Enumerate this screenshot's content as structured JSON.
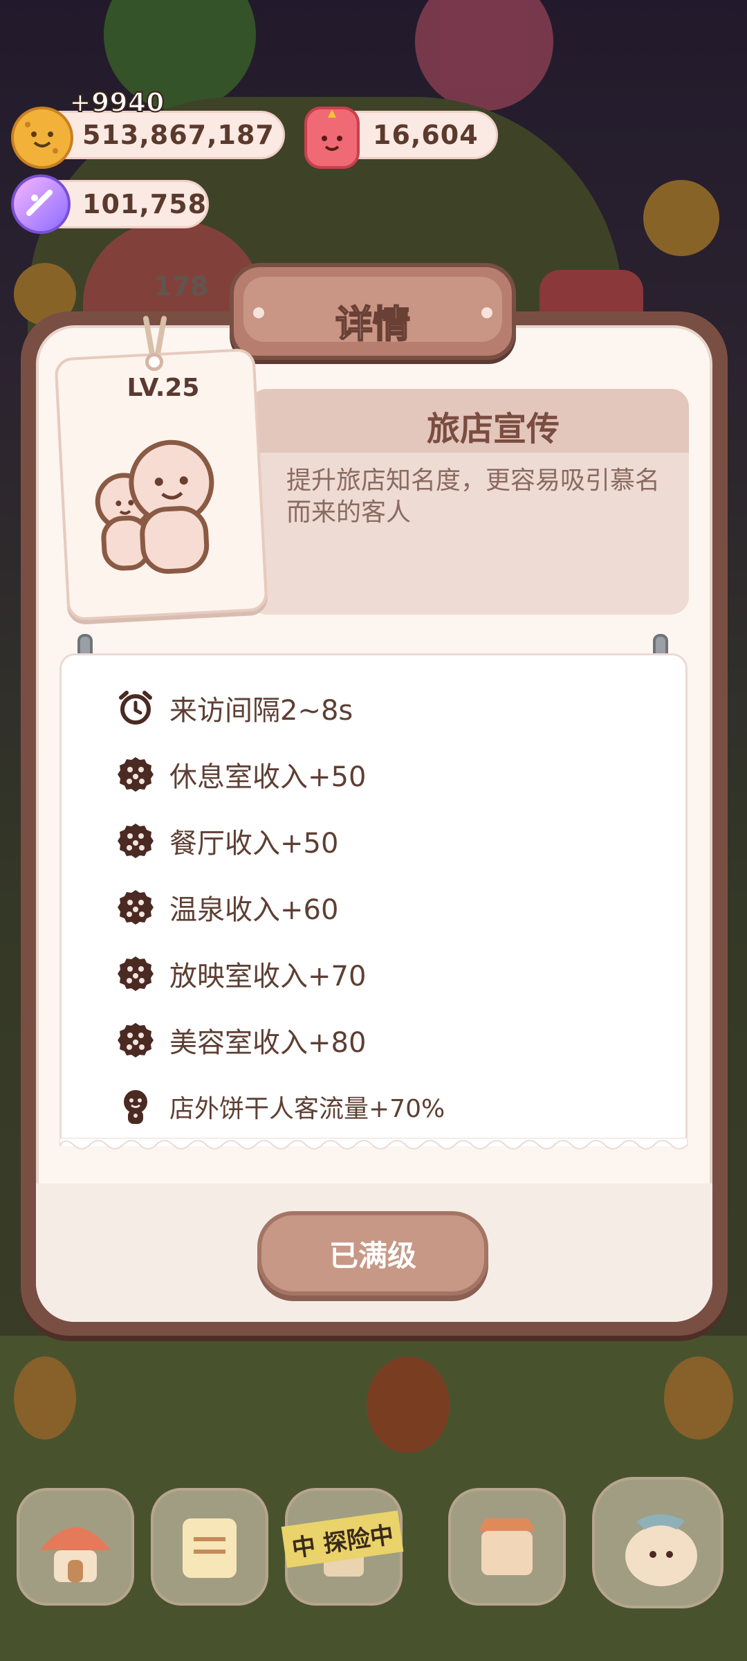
{
  "resources": {
    "cookies": {
      "value": "513,867,187",
      "gain": "+9940",
      "icon": "cookie-coin-icon"
    },
    "jelly": {
      "value": "16,604",
      "icon": "strawberry-jelly-icon"
    },
    "crystal": {
      "value": "101,758",
      "icon": "crystal-candy-icon"
    }
  },
  "background": {
    "counter": "178"
  },
  "modal": {
    "title": "详情",
    "level": "LV.25",
    "skill_name": "旅店宣传",
    "skill_description": "提升旅店知名度，更容易吸引慕名而来的客人",
    "effects": [
      {
        "icon": "alarm-clock-icon",
        "text": "来访间隔2~8s"
      },
      {
        "icon": "cookie-icon",
        "text": "休息室收入+50"
      },
      {
        "icon": "cookie-icon",
        "text": "餐厅收入+50"
      },
      {
        "icon": "cookie-icon",
        "text": "温泉收入+60"
      },
      {
        "icon": "cookie-icon",
        "text": "放映室收入+70"
      },
      {
        "icon": "cookie-icon",
        "text": "美容室收入+80"
      },
      {
        "icon": "gingerbread-person-icon",
        "text": "店外饼干人客流量+70%"
      }
    ],
    "button_label": "已满级"
  },
  "bottom_nav": {
    "exploring_label": "中 探险中"
  },
  "colors": {
    "frame": "#7a4f43",
    "panel": "#fdf6f0",
    "text_brown": "#5e3f34",
    "button": "#c79886"
  }
}
